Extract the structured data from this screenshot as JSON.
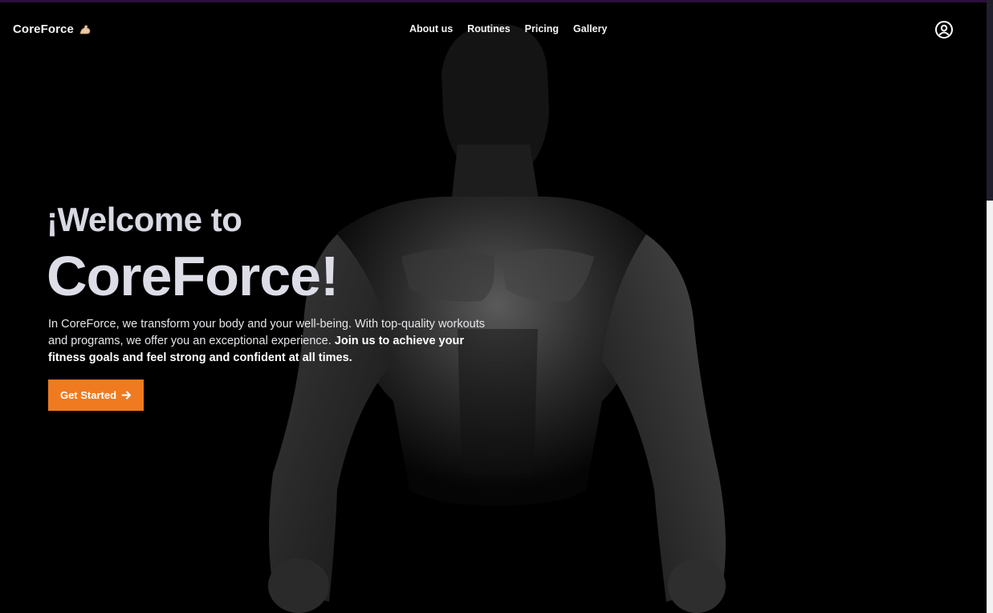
{
  "brand": {
    "name": "CoreForce",
    "icon": "flexed-biceps-icon"
  },
  "nav": {
    "items": [
      {
        "label": "About us"
      },
      {
        "label": "Routines"
      },
      {
        "label": "Pricing"
      },
      {
        "label": "Gallery"
      }
    ]
  },
  "header": {
    "account_icon": "user-circle-icon"
  },
  "hero": {
    "welcome": "¡Welcome to",
    "title": "CoreForce!",
    "description_regular": "In CoreForce, we transform your body and your well-being. With top-quality workouts and programs, we offer you an exceptional experience. ",
    "description_bold": "Join us to achieve your fitness goals and feel strong and confident at all times.",
    "cta_label": "Get Started",
    "cta_icon": "arrow-right-icon"
  },
  "colors": {
    "background": "#000000",
    "accent": "#f07a1f",
    "text": "#dcdde6"
  }
}
